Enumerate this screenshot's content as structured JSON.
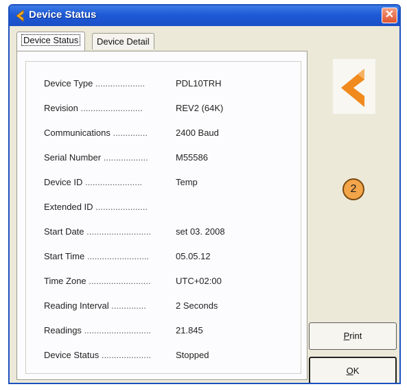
{
  "window": {
    "title": "Device Status"
  },
  "tabs": [
    {
      "label": "Device Status",
      "active": true
    },
    {
      "label": "Device Detail",
      "active": false
    }
  ],
  "fields": [
    {
      "label": "Device Type",
      "dots": "....................",
      "value": "PDL10TRH"
    },
    {
      "label": "Revision",
      "dots": ".........................",
      "value": "REV2 (64K)"
    },
    {
      "label": "Communications",
      "dots": "..............",
      "value": "2400 Baud"
    },
    {
      "label": "Serial Number",
      "dots": "..................",
      "value": "M55586"
    },
    {
      "label": "Device ID",
      "dots": ".......................",
      "value": "Temp"
    },
    {
      "label": "Extended ID",
      "dots": ".....................",
      "value": ""
    },
    {
      "label": "Start Date",
      "dots": "..........................",
      "value": "set 03. 2008"
    },
    {
      "label": "Start Time",
      "dots": ".........................",
      "value": "05.05.12"
    },
    {
      "label": "Time Zone",
      "dots": ".........................",
      "value": "UTC+02:00"
    },
    {
      "label": "Reading Interval",
      "dots": "..............",
      "value": "2 Seconds"
    },
    {
      "label": "Readings",
      "dots": "...........................",
      "value": "21.845"
    },
    {
      "label": "Device Status",
      "dots": "....................",
      "value": "Stopped"
    }
  ],
  "badge": {
    "text": "2"
  },
  "buttons": {
    "print": {
      "mnemonic": "P",
      "rest": "rint"
    },
    "ok": {
      "mnemonic": "O",
      "rest": "K"
    }
  },
  "colors": {
    "titlebar": "#1e5ad6",
    "accent_logo": "#f08a1c",
    "badge": "#f3a54a"
  },
  "icons": {
    "title": "app-logo-icon",
    "close": "close-icon",
    "logo": "device-logo-icon"
  }
}
